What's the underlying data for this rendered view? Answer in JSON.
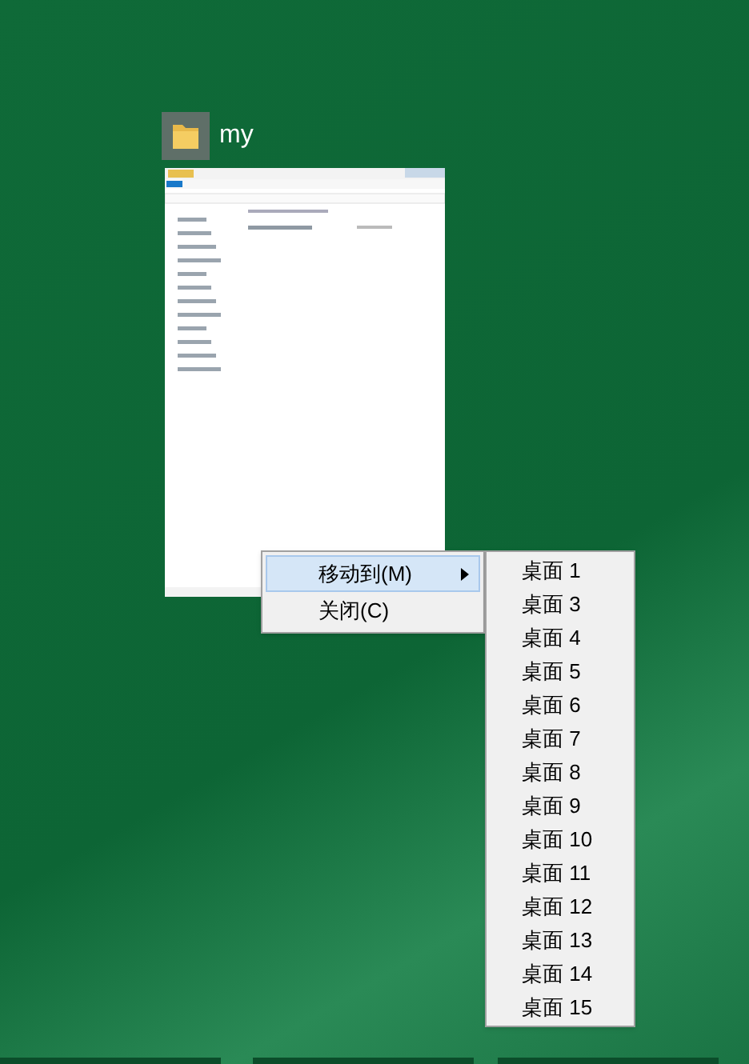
{
  "window": {
    "title": "my"
  },
  "context_menu": [
    {
      "label": "移动到(M)",
      "selected": true,
      "submenu": true
    },
    {
      "label": "关闭(C)",
      "selected": false,
      "submenu": false
    }
  ],
  "submenu": [
    "桌面 1",
    "桌面 3",
    "桌面 4",
    "桌面 5",
    "桌面 6",
    "桌面 7",
    "桌面 8",
    "桌面 9",
    "桌面 10",
    "桌面 11",
    "桌面 12",
    "桌面 13",
    "桌面 14",
    "桌面 15"
  ]
}
